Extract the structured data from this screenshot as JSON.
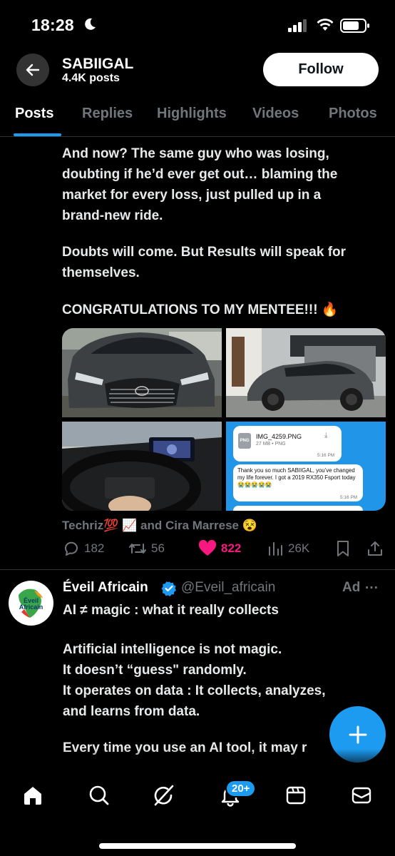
{
  "status_bar": {
    "time": "18:28",
    "icons": [
      "moon-icon",
      "signal-icon",
      "wifi-icon",
      "battery-icon"
    ]
  },
  "profile": {
    "name": "SABIIGAL",
    "posts_count": "4.4K posts",
    "follow_label": "Follow"
  },
  "tabs": [
    {
      "label": "Posts",
      "active": true
    },
    {
      "label": "Replies",
      "active": false
    },
    {
      "label": "Highlights",
      "active": false
    },
    {
      "label": "Videos",
      "active": false
    },
    {
      "label": "Photos",
      "active": false
    }
  ],
  "tweet": {
    "lines": [
      "And now? The same guy who was losing,",
      "doubting if he’d ever get out… blaming the",
      "market for every loss, just pulled up in a",
      "brand-new ride.",
      "Doubts will come. But Results will speak for",
      "themselves.",
      "CONGRATULATIONS TO MY MENTEE!!! 🔥"
    ],
    "chat_screenshot": {
      "file_name": "IMG_4259.PNG",
      "file_meta": "27 MB • PNG",
      "time_1": "5:16 PM",
      "message": "Thank you so much SABIIGAL, you’ve changed my life forever. I got a 2019 RX350 Fsport today 😭😭😭😭😭",
      "time_2": "5:16 PM"
    },
    "reposted_by": "Techriz💯 📈 and Cira Marrese 😵",
    "actions": {
      "replies": "182",
      "reposts": "56",
      "likes": "822",
      "views": "26K"
    }
  },
  "ad": {
    "avatar_text_1": "Éveil",
    "avatar_text_2": "Africain",
    "name": "Éveil Africain",
    "handle": "@Eveil_africain",
    "label": "Ad",
    "more": "···",
    "lines": [
      "AI ≠ magic : what it really collects",
      "Artificial intelligence is not magic.",
      "It doesn’t “guess\" randomly.",
      "It operates on data : It collects, analyzes,",
      "and learns from data.",
      "Every time you use an AI tool, it may r"
    ]
  },
  "bottom_nav": {
    "items": [
      "home-icon",
      "search-icon",
      "grok-icon",
      "notifications-icon",
      "communities-icon",
      "messages-icon"
    ],
    "notifications_badge": "20+"
  },
  "colors": {
    "accent": "#1d9bf0",
    "like": "#f91880",
    "muted": "#71767b",
    "background": "#000000"
  }
}
